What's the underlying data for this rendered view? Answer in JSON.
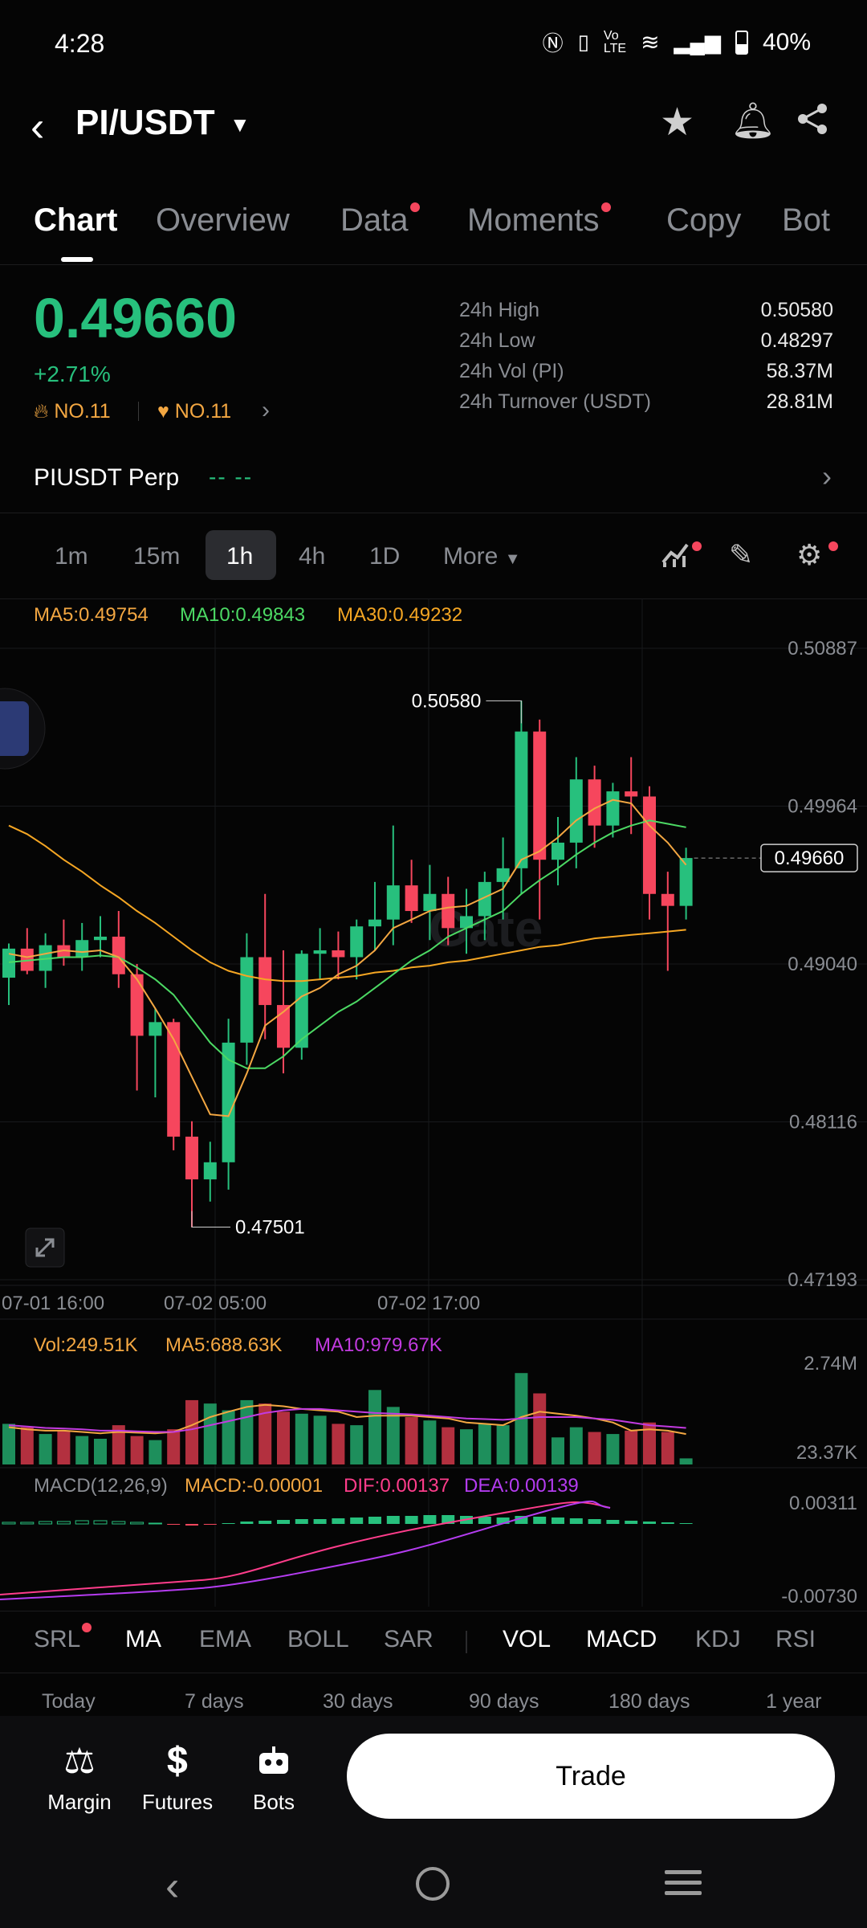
{
  "status_bar": {
    "time": "4:28",
    "battery": "40%",
    "icons": [
      "nfc-icon",
      "vibrate-icon",
      "volte-icon",
      "wifi-icon",
      "signal-icon",
      "battery-icon"
    ]
  },
  "header": {
    "pair": "PI/USDT"
  },
  "tabs": [
    {
      "label": "Chart",
      "active": true,
      "dot": false
    },
    {
      "label": "Overview",
      "active": false,
      "dot": false
    },
    {
      "label": "Data",
      "active": false,
      "dot": true
    },
    {
      "label": "Moments",
      "active": false,
      "dot": true
    },
    {
      "label": "Copy",
      "active": false,
      "dot": false
    },
    {
      "label": "Bot",
      "active": false,
      "dot": false
    }
  ],
  "price": {
    "last": "0.49660",
    "change": "+2.71%",
    "rank1": "NO.11",
    "rank2": "NO.11"
  },
  "stats": [
    {
      "label": "24h High",
      "value": "0.50580"
    },
    {
      "label": "24h Low",
      "value": "0.48297"
    },
    {
      "label": "24h Vol (PI)",
      "value": "58.37M"
    },
    {
      "label": "24h Turnover (USDT)",
      "value": "28.81M"
    }
  ],
  "perp": {
    "label": "PIUSDT Perp",
    "values": "--  --"
  },
  "intervals": [
    {
      "label": "1m",
      "active": false
    },
    {
      "label": "15m",
      "active": false
    },
    {
      "label": "1h",
      "active": true
    },
    {
      "label": "4h",
      "active": false
    },
    {
      "label": "1D",
      "active": false
    },
    {
      "label": "More",
      "active": false
    }
  ],
  "ma_legend": {
    "ma5": "MA5:0.49754",
    "ma10": "MA10:0.49843",
    "ma30": "MA30:0.49232"
  },
  "colors": {
    "up": "#27c07d",
    "down": "#f6465d",
    "ma5": "#f3a742",
    "ma10": "#4cd964",
    "ma30": "#f5a623",
    "vol_ma10": "#c23be0",
    "dif": "#ff3d8b",
    "dea": "#b43cf0"
  },
  "chart_data": {
    "type": "candlestick",
    "price_axis_ticks": [
      "0.50887",
      "0.49964",
      "0.49040",
      "0.48116",
      "0.47193"
    ],
    "ylim": [
      0.47193,
      0.50887
    ],
    "time_ticks": [
      "07-01 16:00",
      "07-02 05:00",
      "07-02 17:00"
    ],
    "current_price": "0.49660",
    "high_marker": "0.50580",
    "low_marker": "0.47501",
    "candles": [
      {
        "o": 0.4896,
        "h": 0.4916,
        "l": 0.488,
        "c": 0.4913
      },
      {
        "o": 0.4913,
        "h": 0.4925,
        "l": 0.4898,
        "c": 0.49
      },
      {
        "o": 0.49,
        "h": 0.4922,
        "l": 0.489,
        "c": 0.4915
      },
      {
        "o": 0.4915,
        "h": 0.493,
        "l": 0.4903,
        "c": 0.4908
      },
      {
        "o": 0.4908,
        "h": 0.4928,
        "l": 0.49,
        "c": 0.4918
      },
      {
        "o": 0.4918,
        "h": 0.4932,
        "l": 0.4908,
        "c": 0.492
      },
      {
        "o": 0.492,
        "h": 0.4935,
        "l": 0.489,
        "c": 0.4898
      },
      {
        "o": 0.4898,
        "h": 0.4904,
        "l": 0.483,
        "c": 0.4862
      },
      {
        "o": 0.4862,
        "h": 0.4878,
        "l": 0.4826,
        "c": 0.487
      },
      {
        "o": 0.487,
        "h": 0.4872,
        "l": 0.4795,
        "c": 0.4803
      },
      {
        "o": 0.4803,
        "h": 0.4812,
        "l": 0.475,
        "c": 0.4778
      },
      {
        "o": 0.4778,
        "h": 0.48,
        "l": 0.4765,
        "c": 0.4788
      },
      {
        "o": 0.4788,
        "h": 0.4872,
        "l": 0.4772,
        "c": 0.4858
      },
      {
        "o": 0.4858,
        "h": 0.4922,
        "l": 0.4845,
        "c": 0.4908
      },
      {
        "o": 0.4908,
        "h": 0.4945,
        "l": 0.486,
        "c": 0.488
      },
      {
        "o": 0.488,
        "h": 0.4912,
        "l": 0.484,
        "c": 0.4855
      },
      {
        "o": 0.4855,
        "h": 0.4912,
        "l": 0.4848,
        "c": 0.491
      },
      {
        "o": 0.491,
        "h": 0.4925,
        "l": 0.4895,
        "c": 0.4912
      },
      {
        "o": 0.4912,
        "h": 0.4923,
        "l": 0.4895,
        "c": 0.4908
      },
      {
        "o": 0.4908,
        "h": 0.493,
        "l": 0.4895,
        "c": 0.4926
      },
      {
        "o": 0.4926,
        "h": 0.4952,
        "l": 0.4912,
        "c": 0.493
      },
      {
        "o": 0.493,
        "h": 0.4985,
        "l": 0.4915,
        "c": 0.495
      },
      {
        "o": 0.495,
        "h": 0.4965,
        "l": 0.4928,
        "c": 0.4935
      },
      {
        "o": 0.4935,
        "h": 0.4962,
        "l": 0.4918,
        "c": 0.4945
      },
      {
        "o": 0.4945,
        "h": 0.4955,
        "l": 0.4915,
        "c": 0.4925
      },
      {
        "o": 0.4925,
        "h": 0.4948,
        "l": 0.491,
        "c": 0.4932
      },
      {
        "o": 0.4932,
        "h": 0.4958,
        "l": 0.4918,
        "c": 0.4952
      },
      {
        "o": 0.4952,
        "h": 0.4978,
        "l": 0.493,
        "c": 0.496
      },
      {
        "o": 0.496,
        "h": 0.5058,
        "l": 0.4945,
        "c": 0.504
      },
      {
        "o": 0.504,
        "h": 0.5047,
        "l": 0.493,
        "c": 0.4965
      },
      {
        "o": 0.4965,
        "h": 0.499,
        "l": 0.495,
        "c": 0.4975
      },
      {
        "o": 0.4975,
        "h": 0.5025,
        "l": 0.496,
        "c": 0.5012
      },
      {
        "o": 0.5012,
        "h": 0.502,
        "l": 0.4972,
        "c": 0.4985
      },
      {
        "o": 0.4985,
        "h": 0.501,
        "l": 0.4978,
        "c": 0.5005
      },
      {
        "o": 0.5005,
        "h": 0.5025,
        "l": 0.498,
        "c": 0.5002
      },
      {
        "o": 0.5002,
        "h": 0.5008,
        "l": 0.493,
        "c": 0.4945
      },
      {
        "o": 0.4945,
        "h": 0.4958,
        "l": 0.49,
        "c": 0.4938
      },
      {
        "o": 0.4938,
        "h": 0.4972,
        "l": 0.493,
        "c": 0.4966
      }
    ],
    "ma5": [
      0.491,
      0.4908,
      0.491,
      0.4912,
      0.4911,
      0.4912,
      0.4908,
      0.4895,
      0.4878,
      0.486,
      0.4838,
      0.4816,
      0.4815,
      0.484,
      0.4868,
      0.4876,
      0.4885,
      0.489,
      0.4898,
      0.4903,
      0.4912,
      0.4925,
      0.493,
      0.4935,
      0.4937,
      0.4938,
      0.4943,
      0.4948,
      0.4965,
      0.497,
      0.4978,
      0.4988,
      0.4995,
      0.5,
      0.4998,
      0.4985,
      0.4975,
      0.4962
    ],
    "ma10": [
      0.4905,
      0.4906,
      0.4907,
      0.4908,
      0.4908,
      0.4909,
      0.4908,
      0.4902,
      0.4895,
      0.4886,
      0.4872,
      0.4858,
      0.4848,
      0.4843,
      0.4843,
      0.485,
      0.486,
      0.4868,
      0.4876,
      0.4882,
      0.489,
      0.4898,
      0.4906,
      0.4912,
      0.492,
      0.4925,
      0.493,
      0.4935,
      0.4945,
      0.4953,
      0.496,
      0.4968,
      0.4975,
      0.4981,
      0.4985,
      0.4988,
      0.4986,
      0.4984
    ],
    "ma30": [
      0.4985,
      0.498,
      0.4973,
      0.4965,
      0.4958,
      0.495,
      0.4943,
      0.4935,
      0.4928,
      0.492,
      0.4912,
      0.4905,
      0.49,
      0.4897,
      0.4895,
      0.4894,
      0.4894,
      0.4895,
      0.4896,
      0.4897,
      0.4899,
      0.49,
      0.4902,
      0.4903,
      0.4905,
      0.4906,
      0.4908,
      0.491,
      0.4912,
      0.4914,
      0.4915,
      0.4917,
      0.4919,
      0.492,
      0.4921,
      0.4922,
      0.4923,
      0.4924
    ],
    "volume_legend": {
      "vol": "Vol:249.51K",
      "ma5": "MA5:688.63K",
      "ma10": "MA10:979.67K"
    },
    "volume_axis": [
      "2.74M",
      "23.37K"
    ],
    "volume": [
      0.6,
      0.55,
      0.45,
      0.5,
      0.42,
      0.38,
      0.58,
      0.42,
      0.36,
      0.52,
      0.95,
      0.9,
      0.8,
      0.95,
      0.9,
      0.78,
      0.75,
      0.72,
      0.6,
      0.58,
      1.1,
      0.85,
      0.7,
      0.65,
      0.55,
      0.52,
      0.6,
      0.58,
      1.35,
      1.05,
      0.4,
      0.55,
      0.48,
      0.45,
      0.5,
      0.62,
      0.48,
      0.09
    ],
    "vol_ma5": [
      0.55,
      0.52,
      0.5,
      0.5,
      0.48,
      0.46,
      0.48,
      0.47,
      0.46,
      0.48,
      0.58,
      0.7,
      0.78,
      0.85,
      0.88,
      0.86,
      0.82,
      0.8,
      0.78,
      0.7,
      0.72,
      0.72,
      0.72,
      0.7,
      0.68,
      0.62,
      0.6,
      0.58,
      0.7,
      0.78,
      0.75,
      0.72,
      0.68,
      0.62,
      0.5,
      0.52,
      0.5,
      0.45
    ],
    "vol_ma10": [
      0.58,
      0.56,
      0.54,
      0.53,
      0.52,
      0.5,
      0.5,
      0.49,
      0.48,
      0.48,
      0.52,
      0.58,
      0.64,
      0.7,
      0.76,
      0.8,
      0.82,
      0.82,
      0.8,
      0.78,
      0.76,
      0.75,
      0.74,
      0.72,
      0.7,
      0.68,
      0.67,
      0.66,
      0.68,
      0.7,
      0.7,
      0.7,
      0.68,
      0.66,
      0.62,
      0.58,
      0.56,
      0.54
    ],
    "macd_legend": {
      "params": "MACD(12,26,9)",
      "macd": "MACD:-0.00001",
      "dif": "DIF:0.00137",
      "dea": "DEA:0.00139"
    },
    "macd_axis": [
      "0.00311",
      "-0.00730"
    ]
  },
  "indicators": {
    "main": [
      {
        "label": "SRL",
        "on": false,
        "dot": true
      },
      {
        "label": "MA",
        "on": true
      },
      {
        "label": "EMA",
        "on": false
      },
      {
        "label": "BOLL",
        "on": false
      },
      {
        "label": "SAR",
        "on": false
      }
    ],
    "sub": [
      {
        "label": "VOL",
        "on": true
      },
      {
        "label": "MACD",
        "on": true
      },
      {
        "label": "KDJ",
        "on": false
      },
      {
        "label": "RSI",
        "on": false
      }
    ]
  },
  "ranges": [
    "Today",
    "7 days",
    "30 days",
    "90 days",
    "180 days",
    "1 year"
  ],
  "bottom_nav": [
    {
      "label": "Margin",
      "icon": "margin-icon"
    },
    {
      "label": "Futures",
      "icon": "futures-icon"
    },
    {
      "label": "Bots",
      "icon": "bots-icon"
    }
  ],
  "trade_label": "Trade"
}
